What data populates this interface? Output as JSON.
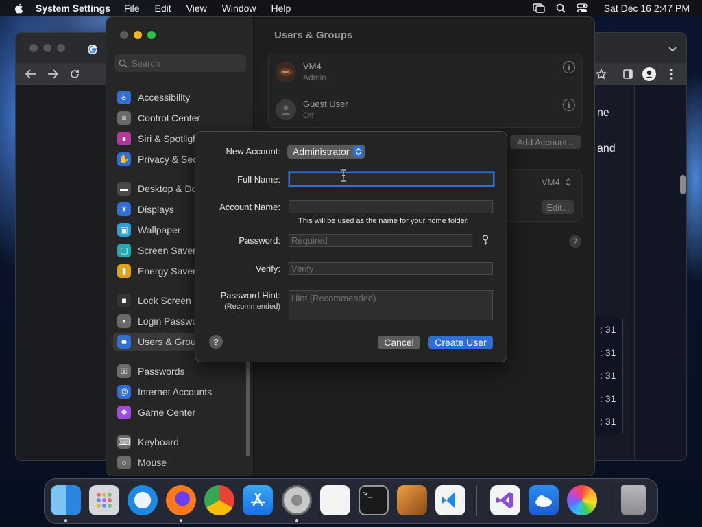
{
  "menubar": {
    "app_name": "System Settings",
    "menus": [
      "File",
      "Edit",
      "View",
      "Window",
      "Help"
    ],
    "clock": "Sat Dec 16  2:47 PM"
  },
  "settings": {
    "search_placeholder": "Search",
    "sidebar": [
      {
        "label": "Accessibility",
        "icon": "accessibility-icon",
        "color": "#2f6fd6"
      },
      {
        "label": "Control Center",
        "icon": "control-center-icon",
        "color": "#6a6a6a"
      },
      {
        "label": "Siri & Spotlight",
        "icon": "siri-icon",
        "color": "#b4389c"
      },
      {
        "label": "Privacy & Security",
        "icon": "hand-icon",
        "color": "#2f6fd6"
      },
      {
        "label": "Desktop & Dock",
        "icon": "dock-icon",
        "color": "#4a4a4a"
      },
      {
        "label": "Displays",
        "icon": "sun-icon",
        "color": "#2f6fd6"
      },
      {
        "label": "Wallpaper",
        "icon": "wallpaper-icon",
        "color": "#2aa1d8"
      },
      {
        "label": "Screen Saver",
        "icon": "screen-saver-icon",
        "color": "#25a8b0"
      },
      {
        "label": "Energy Saver",
        "icon": "battery-icon",
        "color": "#e0a21c"
      },
      {
        "label": "Lock Screen",
        "icon": "lock-icon",
        "color": "#333333"
      },
      {
        "label": "Login Password",
        "icon": "login-password-icon",
        "color": "#6a6a6a"
      },
      {
        "label": "Users & Groups",
        "icon": "users-icon",
        "color": "#2f6fd6"
      },
      {
        "label": "Passwords",
        "icon": "key-icon",
        "color": "#6a6a6a"
      },
      {
        "label": "Internet Accounts",
        "icon": "at-icon",
        "color": "#2f6fd6"
      },
      {
        "label": "Game Center",
        "icon": "game-center-icon",
        "color": "#9a4fd6"
      },
      {
        "label": "Keyboard",
        "icon": "keyboard-icon",
        "color": "#6a6a6a"
      },
      {
        "label": "Mouse",
        "icon": "mouse-icon",
        "color": "#6a6a6a"
      }
    ],
    "main_title": "Users & Groups",
    "users": [
      {
        "name": "VM4",
        "role": "Admin"
      },
      {
        "name": "Guest User",
        "role": "Off"
      }
    ],
    "add_account_label": "Add Account...",
    "auto_login_value": "VM4",
    "edit_label": "Edit..."
  },
  "sheet": {
    "new_account_label": "New Account:",
    "account_type": "Administrator",
    "full_name_label": "Full Name:",
    "full_name_value": "",
    "account_name_label": "Account Name:",
    "account_name_value": "",
    "account_name_note": "This will be used as the name for your home folder.",
    "password_label": "Password:",
    "password_placeholder": "Required",
    "verify_label": "Verify:",
    "verify_placeholder": "Verify",
    "hint_label": "Password Hint:",
    "hint_sublabel": "(Recommended)",
    "hint_placeholder": "Hint (Recommended)",
    "cancel_label": "Cancel",
    "create_label": "Create User"
  },
  "background_window": {
    "peek_texts": [
      "ne",
      "and"
    ],
    "list_items": [
      ": 31",
      ": 31",
      ": 31",
      ": 31",
      ": 31"
    ]
  },
  "dock": [
    "finder-icon",
    "launchpad-icon",
    "safari-icon",
    "firefox-icon",
    "chrome-icon",
    "app-store-icon",
    "system-settings-icon",
    "textedit-icon",
    "terminal-icon",
    "garageband-icon",
    "vscode-icon",
    "visual-studio-icon",
    "weather-icon",
    "photos-icon",
    "trash-icon"
  ]
}
